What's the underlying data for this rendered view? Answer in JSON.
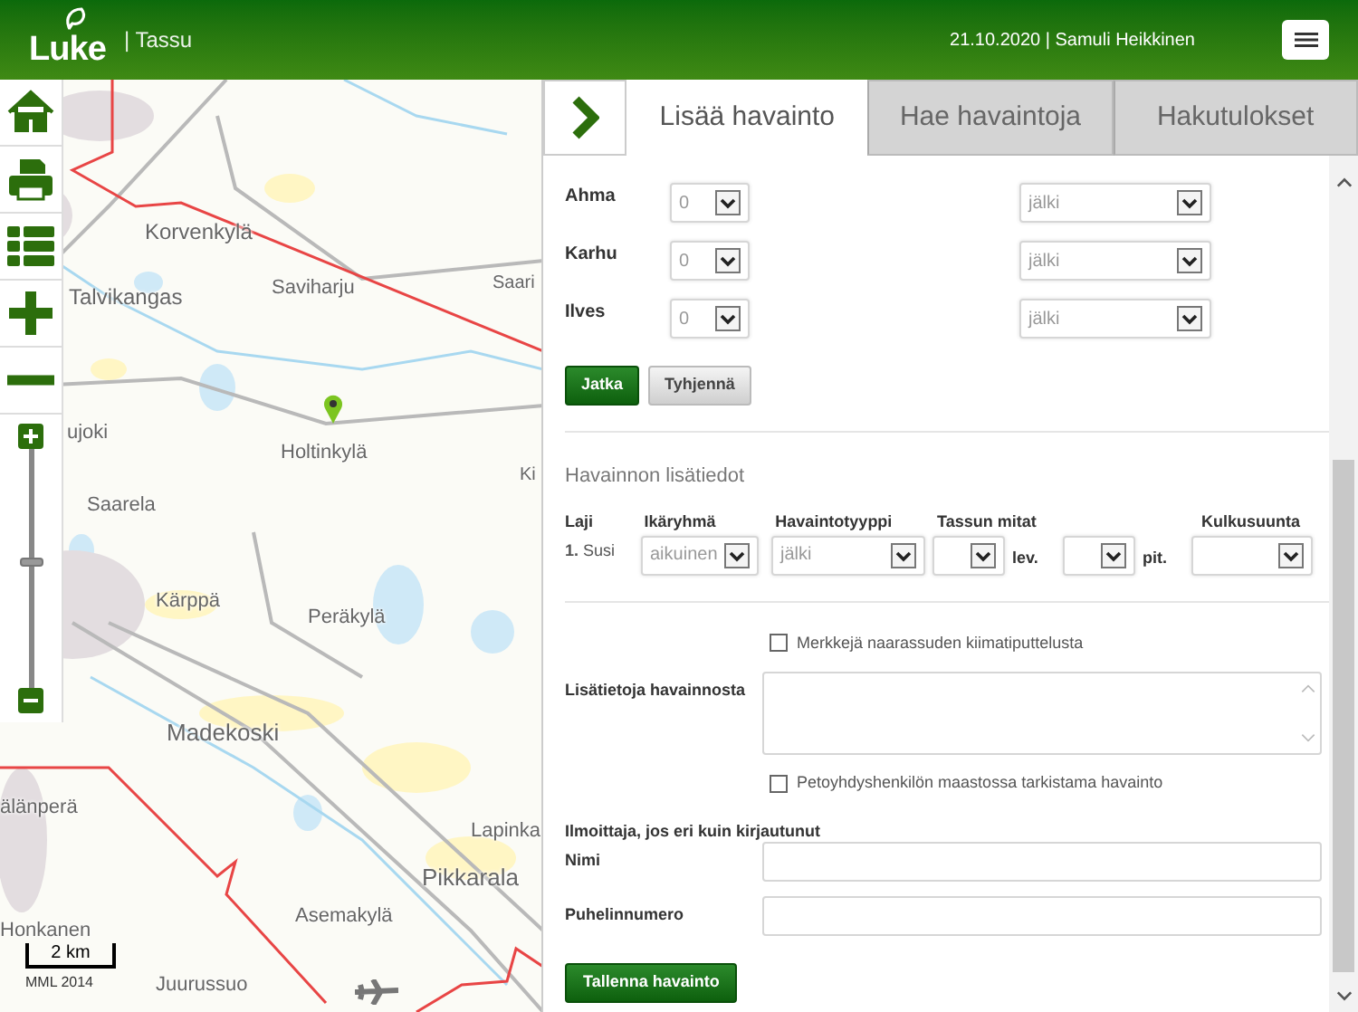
{
  "header": {
    "logo": "Luke",
    "app_name": "| Tassu",
    "user_info": "21.10.2020 | Samuli Heikkinen"
  },
  "map": {
    "labels": [
      {
        "text": "Korvenkylä"
      },
      {
        "text": "Talvikangas"
      },
      {
        "text": "Saviharju"
      },
      {
        "text": "Saari"
      },
      {
        "text": "ujoki"
      },
      {
        "text": "Holtinkylä"
      },
      {
        "text": "Ki"
      },
      {
        "text": "Saarela"
      },
      {
        "text": "Kärppä"
      },
      {
        "text": "Peräkylä"
      },
      {
        "text": "Madekoski"
      },
      {
        "text": "älänperä"
      },
      {
        "text": "Lapinka"
      },
      {
        "text": "Pikkarala"
      },
      {
        "text": "Asemakylä"
      },
      {
        "text": "Honkanen"
      },
      {
        "text": "Juurussuo"
      }
    ],
    "scale": "2 km",
    "attribution": "MML 2014",
    "zoom_slider": {
      "level": 0.53
    }
  },
  "tabs": [
    {
      "label": "Lisää havainto",
      "selected": true
    },
    {
      "label": "Hae havaintoja",
      "selected": false
    },
    {
      "label": "Hakutulokset",
      "selected": false
    }
  ],
  "species_rows": [
    {
      "name": "Ahma",
      "count": "0",
      "type": "jälki"
    },
    {
      "name": "Karhu",
      "count": "0",
      "type": "jälki"
    },
    {
      "name": "Ilves",
      "count": "0",
      "type": "jälki"
    }
  ],
  "buttons": [
    {
      "label": "Jatka",
      "kind": "primary"
    },
    {
      "label": "Tyhjennä",
      "kind": "secondary"
    }
  ],
  "details": {
    "title": "Havainnon lisätiedot",
    "headers": [
      "Laji",
      "Ikäryhmä",
      "Havaintotyyppi",
      "Tassun mitat",
      "Kulkusuunta"
    ],
    "row": {
      "number": "1.",
      "species": "Susi",
      "age": "aikuinen",
      "type": "jälki",
      "width_unit": "lev.",
      "length_unit": "pit."
    }
  },
  "checkbox_estrus": {
    "label": "Merkkejä naarassuden kiimatiputtelusta",
    "checked": false
  },
  "notes_label": "Lisätietoja havainnosta",
  "checkbox_verified": {
    "label": "Petoyhdyshenkilön maastossa tarkistama havainto",
    "checked": false
  },
  "reporter": {
    "heading": "Ilmoittaja, jos eri kuin kirjautunut",
    "fields": [
      {
        "label": "Nimi"
      },
      {
        "label": "Puhelinnumero"
      }
    ]
  },
  "save_button": "Tallenna havainto"
}
